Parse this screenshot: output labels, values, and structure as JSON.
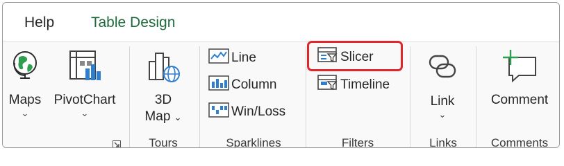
{
  "tabs": {
    "help": "Help",
    "table_design": "Table Design"
  },
  "groups": {
    "charts": {
      "maps_label": "Maps",
      "pivotchart_label": "PivotChart"
    },
    "tours": {
      "map3d_line1": "3D",
      "map3d_line2": "Map",
      "label": "Tours"
    },
    "sparklines": {
      "line_label": "Line",
      "column_label": "Column",
      "winloss_label": "Win/Loss",
      "label": "Sparklines"
    },
    "filters": {
      "slicer_label": "Slicer",
      "timeline_label": "Timeline",
      "label": "Filters"
    },
    "links": {
      "link_label": "Link",
      "label": "Links"
    },
    "comments": {
      "comment_label": "Comment",
      "label": "Comments"
    }
  },
  "colors": {
    "accent_green": "#1d6b3c",
    "highlight_red": "#e0262b",
    "icon_blue": "#2f7fd0"
  }
}
